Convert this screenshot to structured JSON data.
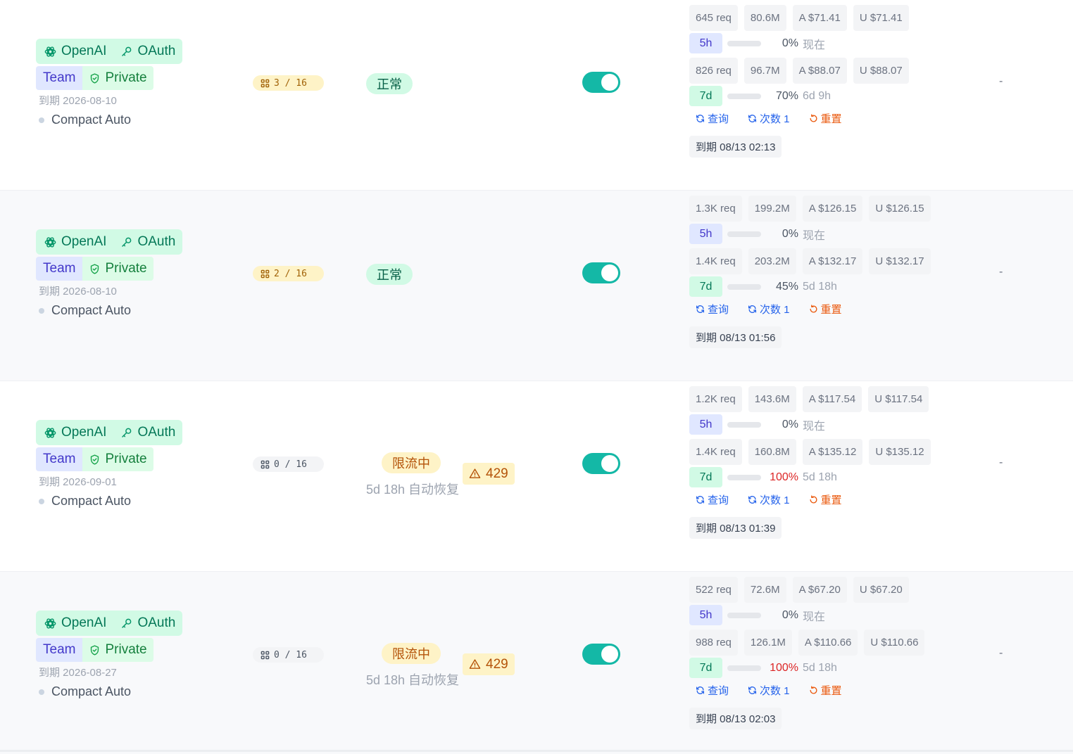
{
  "rows": [
    {
      "provider": "OpenAI",
      "auth": "OAuth",
      "plan": "Team",
      "visibility": "Private",
      "expire_date": "到期 2026-08-10",
      "mode": "Compact Auto",
      "concurrency": "3 / 16",
      "concurrency_active": true,
      "status": "正常",
      "status_type": "ok",
      "enabled": true,
      "usage_5h": {
        "requests": "645 req",
        "tokens": "80.6M",
        "actual": "A $71.41",
        "user": "U $71.41",
        "label": "5h",
        "percent": 0,
        "percent_text": "0%",
        "reset": "现在"
      },
      "usage_7d": {
        "requests": "826 req",
        "tokens": "96.7M",
        "actual": "A $88.07",
        "user": "U $88.07",
        "label": "7d",
        "percent": 70,
        "percent_text": "70%",
        "reset": "6d 9h"
      },
      "actions": {
        "query": "查询",
        "count": "次数 1",
        "reset": "重置"
      },
      "expiry_chip": "到期 08/13 02:13",
      "extra": "-"
    },
    {
      "provider": "OpenAI",
      "auth": "OAuth",
      "plan": "Team",
      "visibility": "Private",
      "expire_date": "到期 2026-08-10",
      "mode": "Compact Auto",
      "concurrency": "2 / 16",
      "concurrency_active": true,
      "status": "正常",
      "status_type": "ok",
      "enabled": true,
      "usage_5h": {
        "requests": "1.3K req",
        "tokens": "199.2M",
        "actual": "A $126.15",
        "user": "U $126.15",
        "label": "5h",
        "percent": 0,
        "percent_text": "0%",
        "reset": "现在"
      },
      "usage_7d": {
        "requests": "1.4K req",
        "tokens": "203.2M",
        "actual": "A $132.17",
        "user": "U $132.17",
        "label": "7d",
        "percent": 45,
        "percent_text": "45%",
        "reset": "5d 18h"
      },
      "actions": {
        "query": "查询",
        "count": "次数 1",
        "reset": "重置"
      },
      "expiry_chip": "到期 08/13 01:56",
      "extra": "-"
    },
    {
      "provider": "OpenAI",
      "auth": "OAuth",
      "plan": "Team",
      "visibility": "Private",
      "expire_date": "到期 2026-09-01",
      "mode": "Compact Auto",
      "concurrency": "0 / 16",
      "concurrency_active": false,
      "status": "限流中",
      "status_type": "ratelimited",
      "status_note": "5d 18h 自动恢复",
      "error_code": "429",
      "enabled": true,
      "usage_5h": {
        "requests": "1.2K req",
        "tokens": "143.6M",
        "actual": "A $117.54",
        "user": "U $117.54",
        "label": "5h",
        "percent": 0,
        "percent_text": "0%",
        "reset": "现在"
      },
      "usage_7d": {
        "requests": "1.4K req",
        "tokens": "160.8M",
        "actual": "A $135.12",
        "user": "U $135.12",
        "label": "7d",
        "percent": 100,
        "percent_text": "100%",
        "reset": "5d 18h"
      },
      "actions": {
        "query": "查询",
        "count": "次数 1",
        "reset": "重置"
      },
      "expiry_chip": "到期 08/13 01:39",
      "extra": "-"
    },
    {
      "provider": "OpenAI",
      "auth": "OAuth",
      "plan": "Team",
      "visibility": "Private",
      "expire_date": "到期 2026-08-27",
      "mode": "Compact Auto",
      "concurrency": "0 / 16",
      "concurrency_active": false,
      "status": "限流中",
      "status_type": "ratelimited",
      "status_note": "5d 18h 自动恢复",
      "error_code": "429",
      "enabled": true,
      "usage_5h": {
        "requests": "522 req",
        "tokens": "72.6M",
        "actual": "A $67.20",
        "user": "U $67.20",
        "label": "5h",
        "percent": 0,
        "percent_text": "0%",
        "reset": "现在"
      },
      "usage_7d": {
        "requests": "988 req",
        "tokens": "126.1M",
        "actual": "A $110.66",
        "user": "U $110.66",
        "label": "7d",
        "percent": 100,
        "percent_text": "100%",
        "reset": "5d 18h"
      },
      "actions": {
        "query": "查询",
        "count": "次数 1",
        "reset": "重置"
      },
      "expiry_chip": "到期 08/13 02:03",
      "extra": "-"
    }
  ],
  "colors": {
    "accent_teal": "#14b8a6",
    "bar_ok": "#22c55e",
    "bar_full": "#ef4444",
    "provider_green": "#047857"
  },
  "icons": {
    "provider": "openai-logo-icon",
    "auth": "key-icon",
    "visibility": "shield-check-icon",
    "concurrency": "grid-icon",
    "warning": "warning-triangle-icon",
    "query": "refresh-icon",
    "count": "refresh-icon",
    "reset": "rotate-ccw-icon"
  }
}
